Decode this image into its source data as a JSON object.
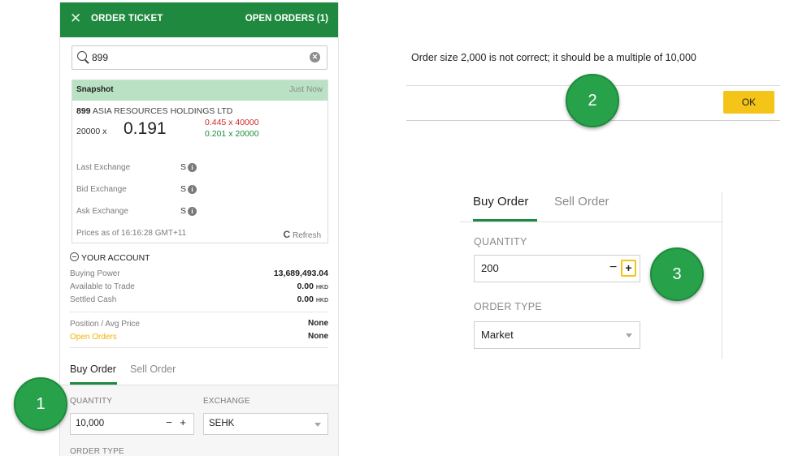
{
  "panel1": {
    "header": {
      "close": "✕",
      "title": "ORDER TICKET",
      "open_orders": "OPEN ORDERS (1)"
    },
    "search": {
      "value": "899",
      "clear": "✕"
    },
    "snapshot": {
      "title": "Snapshot",
      "time": "Just Now",
      "code": "899",
      "company": "ASIA RESOURCES HOLDINGS LTD",
      "volume": "20000 x",
      "price": "0.191",
      "ask": "0.445 x 40000",
      "bid": "0.201 x 20000",
      "exchanges": [
        {
          "label": "Last Exchange",
          "value": "S"
        },
        {
          "label": "Bid Exchange",
          "value": "S"
        },
        {
          "label": "Ask Exchange",
          "value": "S"
        }
      ],
      "info_glyph": "i",
      "prices_as_of": "Prices as of 16:16:28 GMT+11",
      "refresh": "Refresh",
      "refresh_glyph": "C"
    },
    "account": {
      "title": "YOUR ACCOUNT",
      "rows": [
        {
          "label": "Buying Power",
          "value": "13,689,493.04",
          "ccy": ""
        },
        {
          "label": "Available to Trade",
          "value": "0.00",
          "ccy": "HKD"
        },
        {
          "label": "Settled Cash",
          "value": "0.00",
          "ccy": "HKD"
        }
      ],
      "position_label": "Position / Avg Price",
      "position_value": "None",
      "open_orders_label": "Open Orders",
      "open_orders_value": "None"
    },
    "tabs": {
      "buy": "Buy Order",
      "sell": "Sell Order"
    },
    "quantity_label": "QUANTITY",
    "quantity_value": "10,000",
    "stepper": "− +",
    "exchange_label": "EXCHANGE",
    "exchange_value": "SEHK",
    "order_type_label": "ORDER TYPE"
  },
  "badges": {
    "one": "1",
    "two": "2",
    "three": "3"
  },
  "panel2": {
    "message": "Order size 2,000 is not correct; it should be a multiple of 10,000",
    "ok": "OK"
  },
  "panel3": {
    "tabs": {
      "buy": "Buy Order",
      "sell": "Sell Order"
    },
    "quantity_label": "QUANTITY",
    "quantity_value": "200",
    "minus": "−",
    "plus": "+",
    "order_type_label": "ORDER TYPE",
    "order_type_value": "Market"
  },
  "colors": {
    "brand_green": "#1f8a3f",
    "snapshot_green": "#b9e2c4",
    "ask_red": "#d22a2a",
    "ok_yellow": "#f5c418",
    "open_orders_yellow": "#f0b400"
  }
}
